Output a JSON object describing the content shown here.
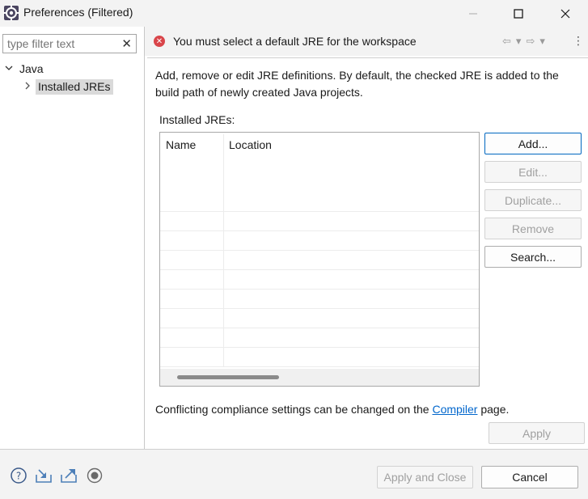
{
  "window": {
    "title": "Preferences (Filtered)",
    "minimize_icon": "minimize-icon",
    "maximize_icon": "maximize-icon",
    "close_icon": "close-icon"
  },
  "sidebar": {
    "filter_placeholder": "type filter text",
    "tree": [
      {
        "label": "Java",
        "expanded": true
      },
      {
        "label": "Installed JREs",
        "selected": true
      }
    ]
  },
  "message": {
    "text": "You must select a default JRE for the workspace",
    "icon": "error-icon"
  },
  "page": {
    "description": "Add, remove or edit JRE definitions. By default, the checked JRE is added to the build path of newly created Java projects.",
    "installed_label": "Installed JREs:",
    "table": {
      "columns": [
        "Name",
        "Location"
      ],
      "rows": []
    },
    "buttons": {
      "add": "Add...",
      "edit": "Edit...",
      "duplicate": "Duplicate...",
      "remove": "Remove",
      "search": "Search..."
    },
    "compliance_prefix": "Conflicting compliance settings can be changed on the ",
    "compliance_link": "Compiler",
    "compliance_suffix": " page.",
    "apply": "Apply"
  },
  "footer": {
    "apply_close": "Apply and Close",
    "cancel": "Cancel"
  },
  "colors": {
    "error": "#d9454a",
    "link": "#0066cc",
    "primary_border": "#0067c0"
  }
}
